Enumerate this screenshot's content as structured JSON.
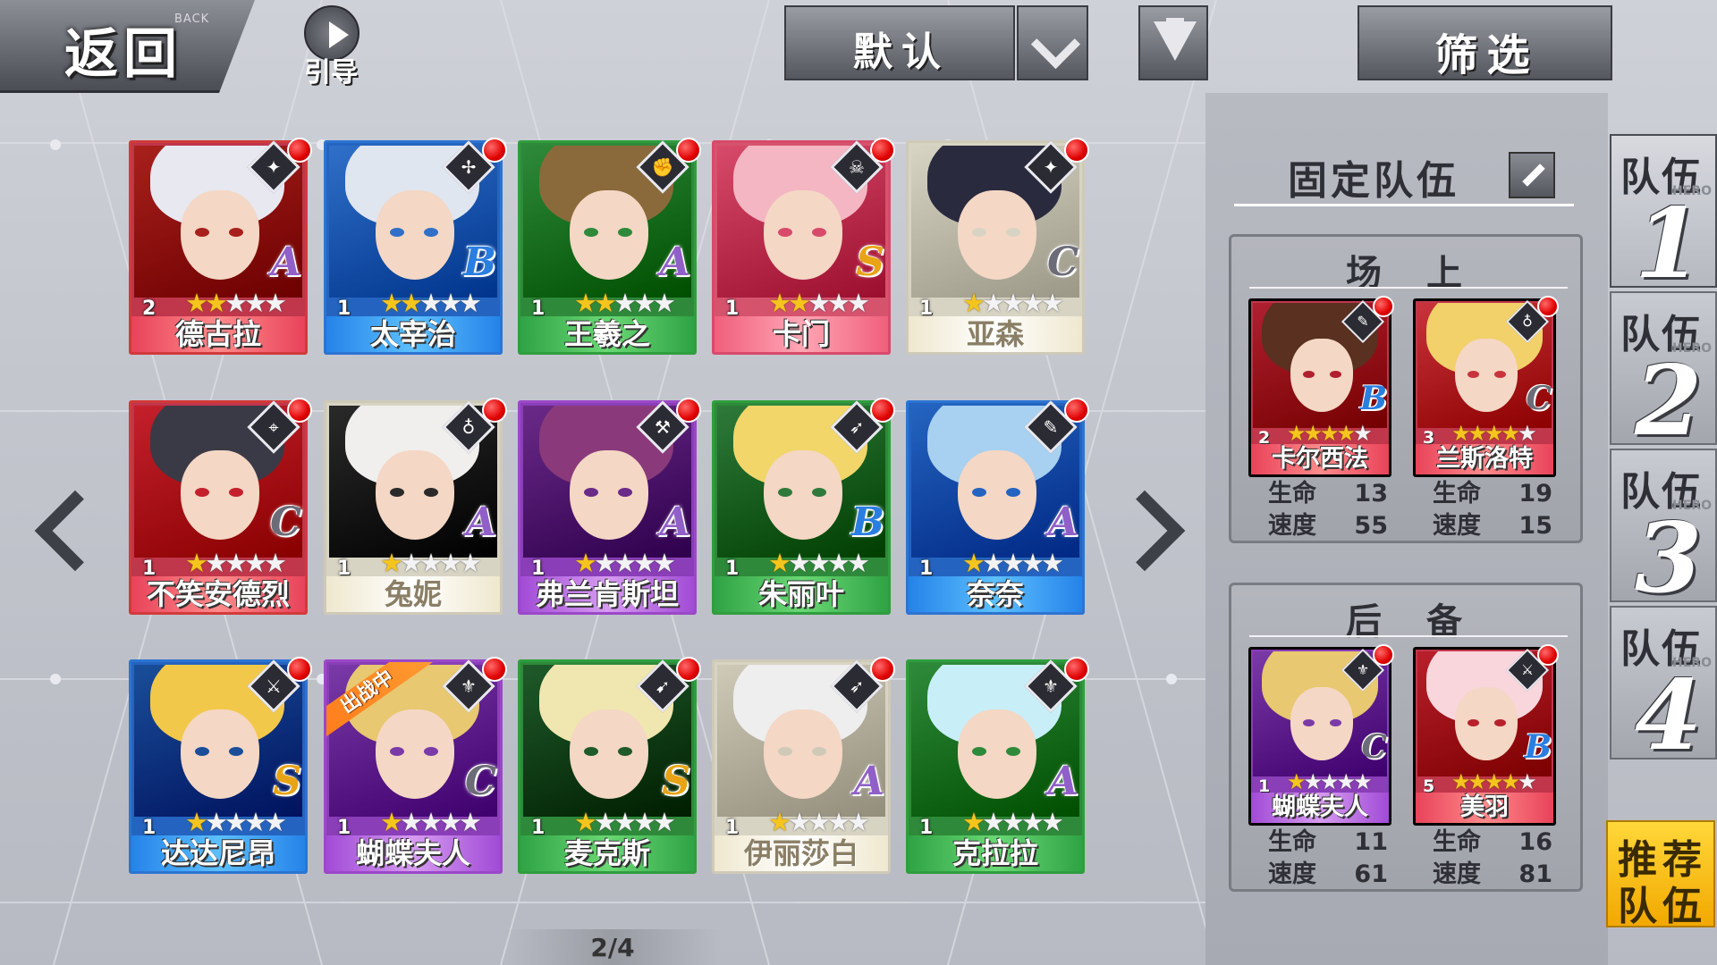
{
  "topbar": {
    "back_label": "返回",
    "back_sub": "BACK",
    "guide_label": "引导",
    "sort_label": "默认",
    "filter_label": "筛选"
  },
  "roster": {
    "page": "2/4",
    "rows": [
      [
        {
          "name": "德古拉",
          "level": "2",
          "stars": 2,
          "rank": "A",
          "rarity": "red",
          "cls": "✦"
        },
        {
          "name": "太宰治",
          "level": "1",
          "stars": 2,
          "rank": "B",
          "rarity": "blue",
          "cls": "✢"
        },
        {
          "name": "王羲之",
          "level": "1",
          "stars": 2,
          "rank": "A",
          "rarity": "green",
          "cls": "✊"
        },
        {
          "name": "卡门",
          "level": "1",
          "stars": 2,
          "rank": "S",
          "rarity": "pink",
          "cls": "☠"
        },
        {
          "name": "亚森",
          "level": "1",
          "stars": 1,
          "rank": "C",
          "rarity": "white",
          "cls": "✦"
        }
      ],
      [
        {
          "name": "不笑安德烈",
          "level": "1",
          "stars": 1,
          "rank": "C",
          "rarity": "red",
          "cls": "⌖"
        },
        {
          "name": "兔妮",
          "level": "1",
          "stars": 1,
          "rank": "A",
          "rarity": "white",
          "cls": "♁"
        },
        {
          "name": "弗兰肯斯坦",
          "level": "1",
          "stars": 1,
          "rank": "A",
          "rarity": "purple",
          "cls": "⚒"
        },
        {
          "name": "朱丽叶",
          "level": "1",
          "stars": 1,
          "rank": "B",
          "rarity": "green",
          "cls": "➶"
        },
        {
          "name": "奈奈",
          "level": "1",
          "stars": 1,
          "rank": "A",
          "rarity": "blue",
          "cls": "✎"
        }
      ],
      [
        {
          "name": "达达尼昂",
          "level": "1",
          "stars": 1,
          "rank": "S",
          "rarity": "blue",
          "cls": "⚔"
        },
        {
          "name": "蝴蝶夫人",
          "level": "1",
          "stars": 1,
          "rank": "C",
          "rarity": "purple",
          "cls": "⚜",
          "banner": "出战中"
        },
        {
          "name": "麦克斯",
          "level": "1",
          "stars": 1,
          "rank": "S",
          "rarity": "green",
          "cls": "➹"
        },
        {
          "name": "伊丽莎白",
          "level": "1",
          "stars": 1,
          "rank": "A",
          "rarity": "white",
          "cls": "➶"
        },
        {
          "name": "克拉拉",
          "level": "1",
          "stars": 1,
          "rank": "A",
          "rarity": "green",
          "cls": "⚜"
        }
      ]
    ]
  },
  "team_panel": {
    "title": "固定队伍",
    "onfield_label": "场上",
    "reserve_label": "后备",
    "stat_hp": "生命",
    "stat_speed": "速度",
    "onfield": [
      {
        "name": "卡尔西法",
        "level": "2",
        "stars": 4,
        "rank": "B",
        "rarity": "red",
        "cls": "✎",
        "hp": "13",
        "speed": "55"
      },
      {
        "name": "兰斯洛特",
        "level": "3",
        "stars": 4,
        "rank": "C",
        "rarity": "red",
        "cls": "♁",
        "hp": "19",
        "speed": "15"
      }
    ],
    "reserve": [
      {
        "name": "蝴蝶夫人",
        "level": "1",
        "stars": 1,
        "rank": "C",
        "rarity": "purple",
        "cls": "⚜",
        "hp": "11",
        "speed": "61"
      },
      {
        "name": "美羽",
        "level": "5",
        "stars": 4,
        "rank": "B",
        "rarity": "red",
        "cls": "⚔",
        "hp": "16",
        "speed": "81"
      }
    ]
  },
  "team_tabs": {
    "label": "队伍",
    "hero": "HERO",
    "items": [
      "1",
      "2",
      "3",
      "4"
    ],
    "active": 0
  },
  "recommend": {
    "line1": "推荐",
    "line2": "队伍"
  },
  "art_palette": {
    "德古拉": [
      "#e8e8f0",
      "#a8201c"
    ],
    "太宰治": [
      "#dfe6ef",
      "#3070c8"
    ],
    "王羲之": [
      "#8a6a3a",
      "#2e8a3a"
    ],
    "卡门": [
      "#f4b6c2",
      "#d84a6a"
    ],
    "亚森": [
      "#2a2a3e",
      "#d8d4c4"
    ],
    "不笑安德烈": [
      "#3a3a46",
      "#c4202c"
    ],
    "兔妮": [
      "#f0efee",
      "#2a2a2a"
    ],
    "弗兰肯斯坦": [
      "#8a3a7a",
      "#6a2a88"
    ],
    "朱丽叶": [
      "#f2d66a",
      "#2e7a3a"
    ],
    "奈奈": [
      "#a8d0f0",
      "#2464c0"
    ],
    "达达尼昂": [
      "#f2c84a",
      "#1a4e9a"
    ],
    "蝴蝶夫人": [
      "#e8c870",
      "#7a3aa8"
    ],
    "麦克斯": [
      "#f0e6b0",
      "#1f5a2a"
    ],
    "伊丽莎白": [
      "#eeeeef",
      "#cfcab8"
    ],
    "克拉拉": [
      "#c8eef8",
      "#2e8a3a"
    ],
    "卡尔西法": [
      "#5a3020",
      "#b02030"
    ],
    "兰斯洛特": [
      "#f2d06a",
      "#c8343c"
    ],
    "美羽": [
      "#f8d6dc",
      "#b8202c"
    ]
  }
}
